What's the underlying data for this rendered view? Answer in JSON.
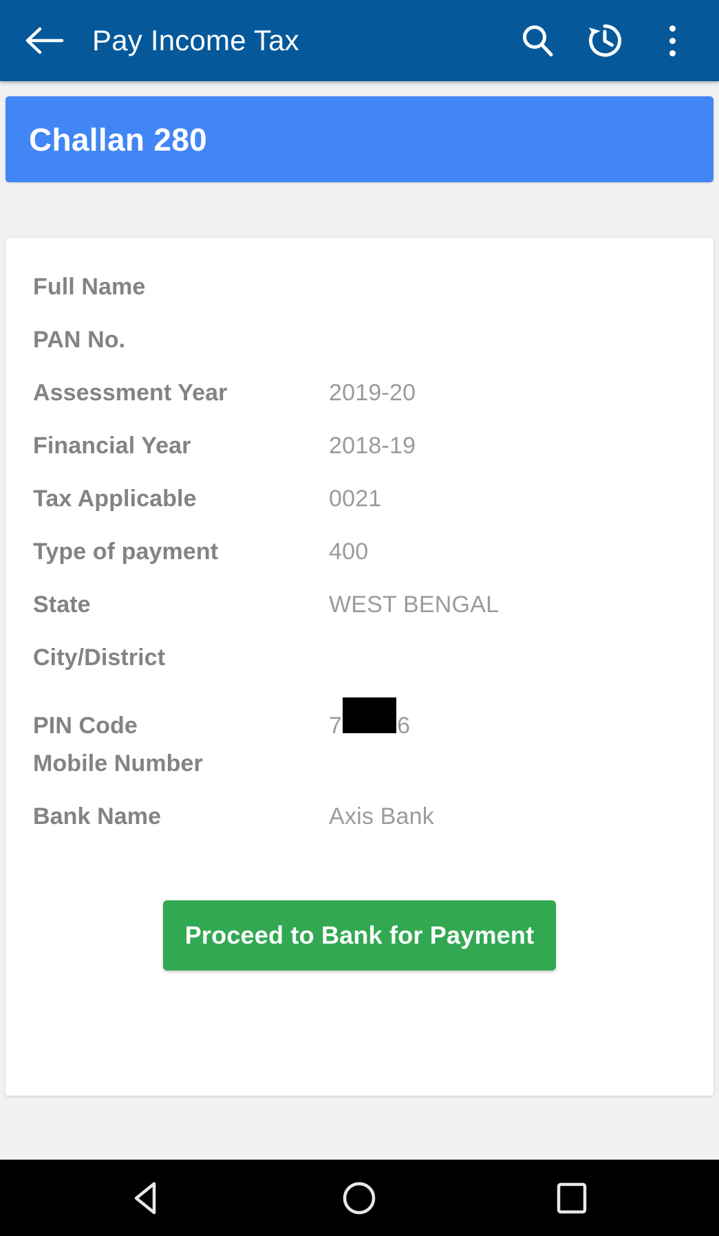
{
  "appbar": {
    "title": "Pay Income Tax",
    "back_icon": "back-arrow-icon",
    "search_icon": "search-icon",
    "history_icon": "history-icon",
    "overflow_icon": "overflow-menu-icon",
    "background_color": "#05599b"
  },
  "banner": {
    "title": "Challan 280",
    "background_color": "#4285f4"
  },
  "form": {
    "rows": [
      {
        "label": "Full Name",
        "value": ""
      },
      {
        "label": "PAN No.",
        "value": ""
      },
      {
        "label": "Assessment Year",
        "value": "2019-20"
      },
      {
        "label": "Financial Year",
        "value": "2018-19"
      },
      {
        "label": "Tax Applicable",
        "value": "0021"
      },
      {
        "label": "Type of payment",
        "value": "400"
      },
      {
        "label": "State",
        "value": "WEST BENGAL"
      },
      {
        "label": "City/District",
        "value": ""
      },
      {
        "label": "PIN Code",
        "value": "",
        "redacted": true,
        "prefix": "7",
        "suffix": "6"
      },
      {
        "label": "Mobile Number",
        "value": ""
      },
      {
        "label": "Bank Name",
        "value": "Axis Bank"
      }
    ],
    "label_color": "#838383",
    "value_color": "#9b9b9b"
  },
  "action": {
    "proceed_label": "Proceed to Bank for Payment",
    "proceed_color": "#32a852"
  },
  "navbar": {
    "back_icon": "nav-back-triangle-icon",
    "home_icon": "nav-home-circle-icon",
    "recents_icon": "nav-recents-square-icon"
  }
}
